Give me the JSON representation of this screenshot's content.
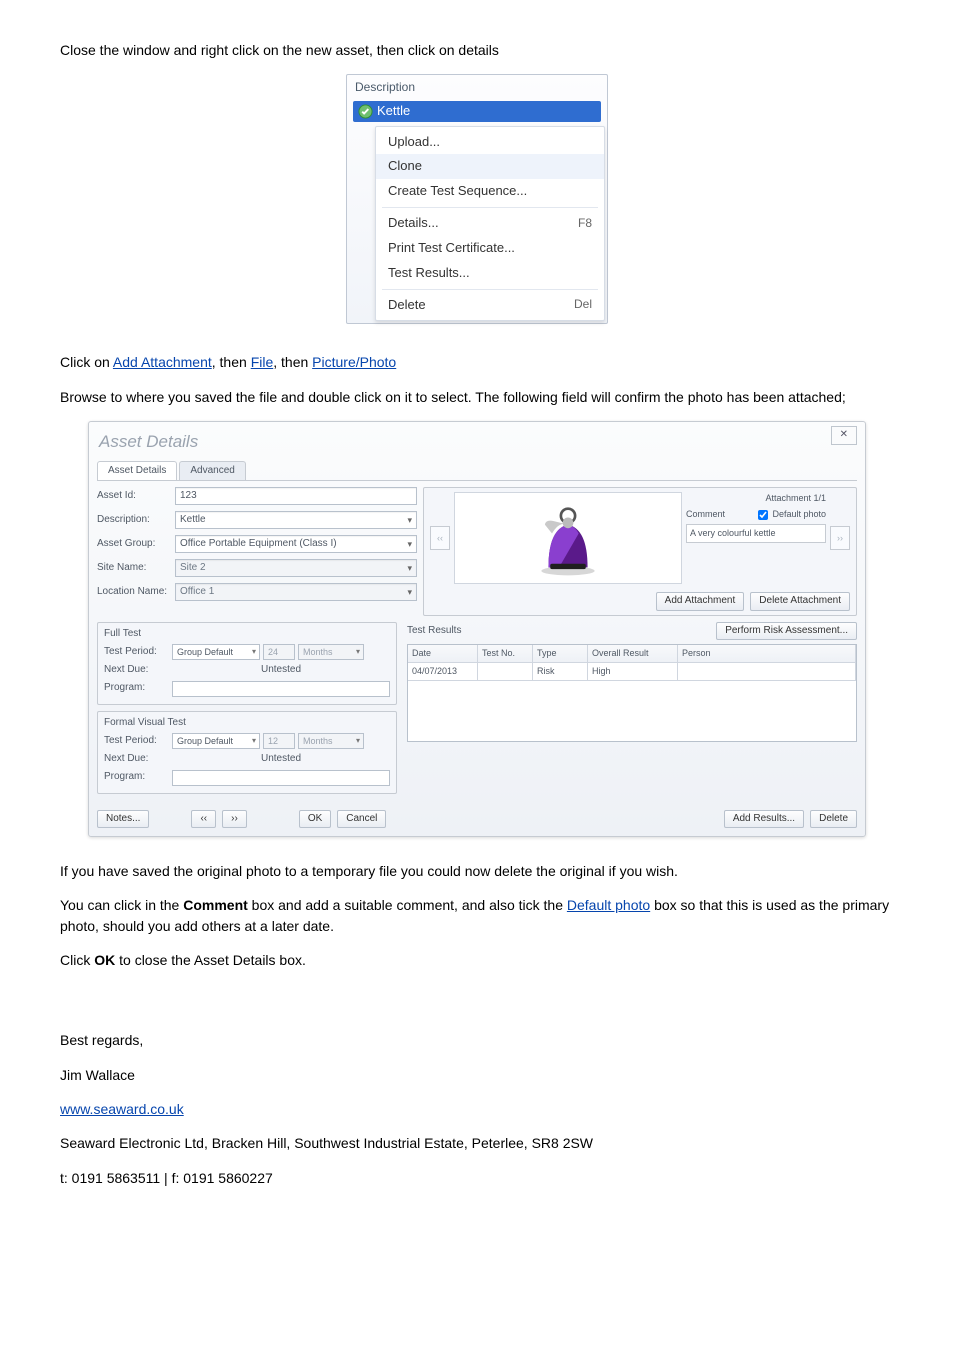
{
  "para_intro": "Close the window and right click on the new asset, then click on details",
  "ctx": {
    "header": "Description",
    "selected": "Kettle",
    "items": [
      {
        "label": "Upload...",
        "key": "",
        "hl": false
      },
      {
        "label": "Clone",
        "key": "",
        "hl": true
      },
      {
        "label": "Create Test Sequence...",
        "key": "",
        "hl": false
      },
      {
        "sep": true
      },
      {
        "label": "Details...",
        "key": "F8",
        "hl": false
      },
      {
        "label": "Print Test Certificate...",
        "key": "",
        "hl": false
      },
      {
        "label": "Test Results...",
        "key": "",
        "hl": false
      },
      {
        "sep": true
      },
      {
        "label": "Delete",
        "key": "Del",
        "hl": false
      }
    ]
  },
  "para_mid1_a": "Click on ",
  "para_mid1_link1": "Add Attachment",
  "para_mid1_b": ", then ",
  "para_mid1_link2": "File",
  "para_mid1_c": ", then ",
  "para_mid1_link3": "Picture/Photo",
  "para_mid2": "Browse to where you saved the file and double click on it to select. The following field will confirm the photo has been attached;",
  "dlg": {
    "close": "✕",
    "title": "Asset Details",
    "tabs": [
      "Asset Details",
      "Advanced"
    ],
    "fields": {
      "asset_id_lbl": "Asset Id:",
      "asset_id": "123",
      "desc_lbl": "Description:",
      "desc": "Kettle",
      "group_lbl": "Asset Group:",
      "group": "Office Portable Equipment (Class I)",
      "site_lbl": "Site Name:",
      "site": "Site 2",
      "loc_lbl": "Location Name:",
      "loc": "Office 1"
    },
    "attachment": {
      "counter": "Attachment 1/1",
      "comment_lbl": "Comment",
      "default_lbl": "Default photo",
      "comment": "A very colourful kettle",
      "prev": "‹‹",
      "next": "››",
      "add": "Add Attachment",
      "del": "Delete Attachment"
    },
    "full_test": {
      "legend": "Full Test",
      "period_lbl": "Test Period:",
      "period": "Group Default",
      "num": "24",
      "unit": "Months",
      "next_lbl": "Next Due:",
      "next": "Untested",
      "prog_lbl": "Program:"
    },
    "visual_test": {
      "legend": "Formal Visual Test",
      "period_lbl": "Test Period:",
      "period": "Group Default",
      "num": "12",
      "unit": "Months",
      "next_lbl": "Next Due:",
      "next": "Untested",
      "prog_lbl": "Program:"
    },
    "results": {
      "title": "Test Results",
      "perform": "Perform Risk Assessment...",
      "headers": [
        "Date",
        "Test No.",
        "Type",
        "Overall Result",
        "Person"
      ],
      "row": [
        "04/07/2013",
        "",
        "Risk",
        "High",
        ""
      ],
      "add": "Add Results...",
      "del": "Delete"
    },
    "footer": {
      "notes": "Notes...",
      "prev": "‹‹",
      "next": "››",
      "ok": "OK",
      "cancel": "Cancel"
    }
  },
  "para_end1": "If you have saved the original photo to a temporary file you could now delete the original if you wish.",
  "para_end2_a": "You can click in the ",
  "para_end2_b": "Comment",
  "para_end2_c": " box and add a suitable comment, and also tick the ",
  "para_end2_link": "Default photo",
  "para_end2_d": " box so that this is used as the primary photo, should you add others at a later date.",
  "para_end3_a": "Click ",
  "para_end3_b": "OK",
  "para_end3_c": " to close the Asset Details box.",
  "sig": {
    "regards": "Best regards,",
    "name": "Jim Wallace",
    "url": "www.seaward.co.uk",
    "addr": "Seaward Electronic Ltd, Bracken Hill, Southwest Industrial Estate, Peterlee, SR8 2SW",
    "tel": "t: 0191 5863511  |  f: 0191 5860227"
  }
}
